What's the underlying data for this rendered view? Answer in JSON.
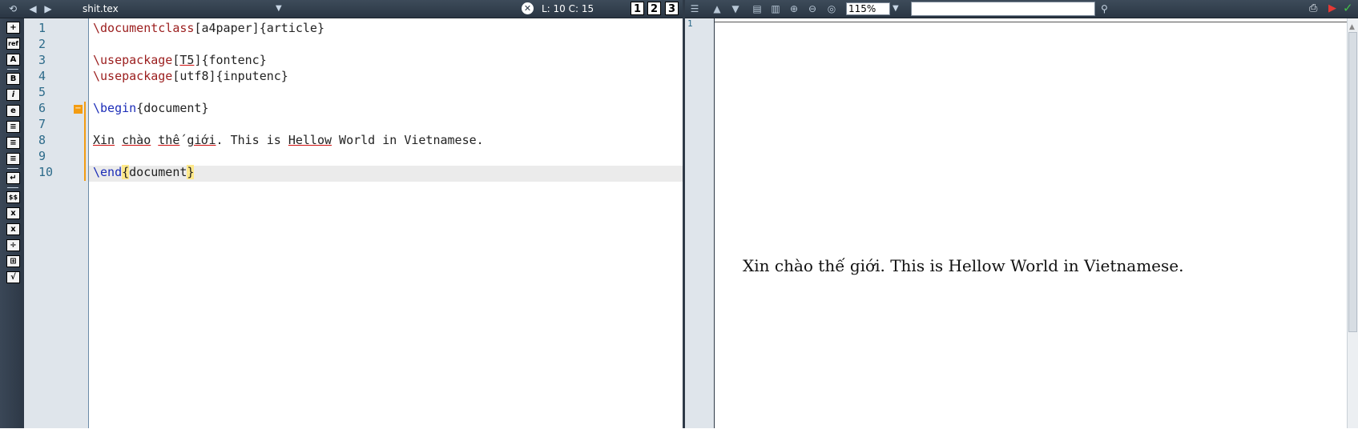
{
  "toolbar": {
    "file_name": "shit.tex",
    "cursor_position": "L: 10 C: 15",
    "bookmarks": [
      "1",
      "2",
      "3"
    ],
    "zoom": "115%",
    "search_placeholder": ""
  },
  "left_toolbar": {
    "buttons": [
      "+",
      "ref",
      "A",
      "B",
      "i",
      "e",
      "≡",
      "≡",
      "≡",
      "↵",
      "$$",
      "x",
      "x",
      "÷",
      "⊞",
      "√"
    ]
  },
  "editor": {
    "lines": [
      "1",
      "2",
      "3",
      "4",
      "5",
      "6",
      "7",
      "8",
      "9",
      "10"
    ],
    "code": {
      "l1_cmd": "\\documentclass",
      "l1_rest": "[a4paper]{article}",
      "l3_cmd": "\\usepackage",
      "l3_a": "[",
      "l3_opt": "T5",
      "l3_b": "]{fontenc}",
      "l4_cmd": "\\usepackage",
      "l4_rest": "[utf8]{inputenc}",
      "l6_cmd": "\\begin",
      "l6_rest": "{document}",
      "l8_w1": "Xin",
      "l8_s1": " ",
      "l8_w2": "chào",
      "l8_s2": " ",
      "l8_w3": "thế",
      "l8_s3": " ",
      "l8_w4": "giới",
      "l8_s4": ". This is ",
      "l8_w5": "Hellow",
      "l8_s5": " World in Vietnamese.",
      "l10_cmd": "\\end",
      "l10_ob": "{",
      "l10_arg": "document",
      "l10_cb": "}"
    }
  },
  "pdf": {
    "page_number": "1",
    "text": "Xin chào thế giới. This is Hellow World in Vietnamese."
  },
  "colors": {
    "toolbar_bg": "#2a3644",
    "keyword": "#9b1d1d",
    "env_keyword": "#1c2db8",
    "fold_marker": "#f39c12",
    "current_line": "#ebebeb"
  }
}
